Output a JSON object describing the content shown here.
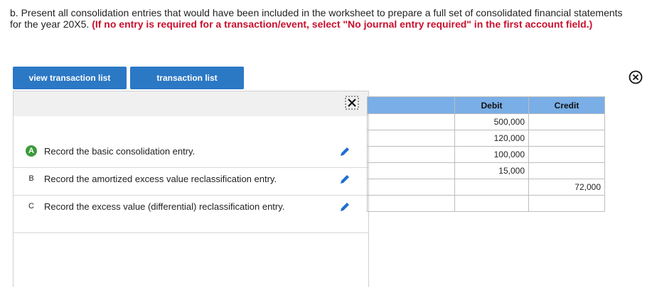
{
  "instructions": {
    "text": "b. Present all consolidation entries that would have been included in the worksheet to prepare a full set of consolidated financial statements for the year 20X5. ",
    "emphasis": "(If no entry is required for a transaction/event, select \"No journal entry required\" in the first account field.)"
  },
  "toolbar": {
    "view_transaction_list": "view transaction list",
    "transaction_list": "transaction list"
  },
  "transactions": [
    {
      "letter": "A",
      "label": "Record the basic consolidation entry.",
      "active": true
    },
    {
      "letter": "B",
      "label": "Record the amortized excess value reclassification entry.",
      "active": false
    },
    {
      "letter": "C",
      "label": "Record the excess value (differential) reclassification entry.",
      "active": false
    }
  ],
  "journal_table": {
    "headers": {
      "account": "",
      "debit": "Debit",
      "credit": "Credit"
    },
    "rows": [
      {
        "debit": "500,000",
        "credit": ""
      },
      {
        "debit": "120,000",
        "credit": ""
      },
      {
        "debit": "100,000",
        "credit": ""
      },
      {
        "debit": "15,000",
        "credit": ""
      },
      {
        "debit": "",
        "credit": "72,000"
      },
      {
        "debit": "",
        "credit": ""
      }
    ]
  },
  "icons": {
    "close": "close-circle-icon",
    "expand": "expand-icon",
    "edit": "pencil-icon"
  },
  "colors": {
    "button": "#2b78c5",
    "header": "#7aaee6",
    "emphasis": "#c8102e",
    "active_badge": "#3c9a3c",
    "pencil": "#1f6fcf"
  }
}
